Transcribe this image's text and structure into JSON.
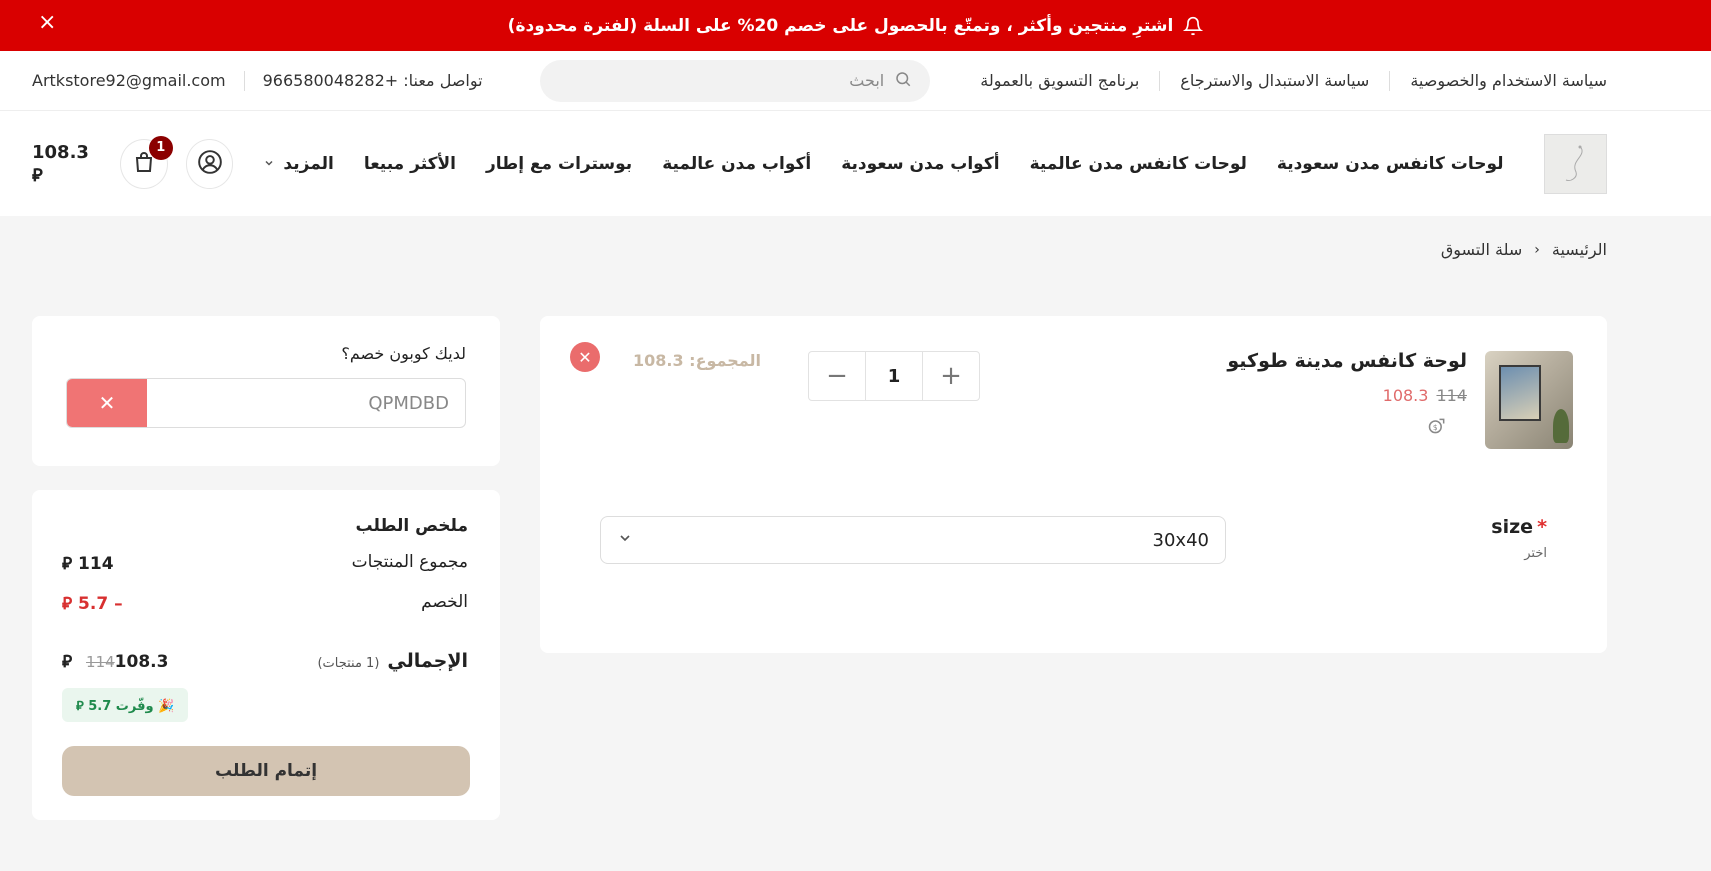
{
  "promo": {
    "text": "اشترِ منتجين وأكثر ، وتمتّع بالحصول على خصم 20% على السلة (لفترة محدودة)",
    "close": "×"
  },
  "topbar": {
    "links": [
      "سياسة الاستخدام والخصوصية",
      "سياسة الاستبدال والاسترجاع",
      "برنامج التسويق بالعمولة"
    ],
    "search_placeholder": "ابحث",
    "contact_label": "تواصل معنا: +966580048282",
    "email": "Artkstore92@gmail.com"
  },
  "navbar": {
    "items": [
      "لوحات كانفس مدن سعودية",
      "لوحات كانفس مدن عالمية",
      "أكواب مدن سعودية",
      "أكواب مدن عالمية",
      "بوسترات مع إطار",
      "الأكثر مبيعا"
    ],
    "more": "المزيد",
    "cart_count": "1",
    "cart_total": "108.3 ⃁"
  },
  "breadcrumb": {
    "home": "الرئيسية",
    "current": "سلة التسوق"
  },
  "cart_item": {
    "name": "لوحة كانفس مدينة طوكيو",
    "old_price": "114",
    "new_price": "108.3",
    "quantity": "1",
    "subtotal": "المجموع: 108.3",
    "size_label": "size",
    "size_required": "*",
    "size_hint": "اختر",
    "size_value": "30x40"
  },
  "coupon": {
    "label": "لديك كوبون خصم؟",
    "code": "QPMDBD"
  },
  "summary": {
    "title": "ملخص الطلب",
    "products_label": "مجموع المنتجات",
    "products_value": "114 ⃁",
    "discount_label": "الخصم",
    "discount_value": "– 5.7 ⃁",
    "total_label": "الإجمالي",
    "total_count": "(1 منتجات)",
    "total_old": "114",
    "total_value": "108.3 ⃁",
    "saved": "🎉 وفّرت 5.7 ⃁",
    "checkout": "إتمام الطلب"
  }
}
